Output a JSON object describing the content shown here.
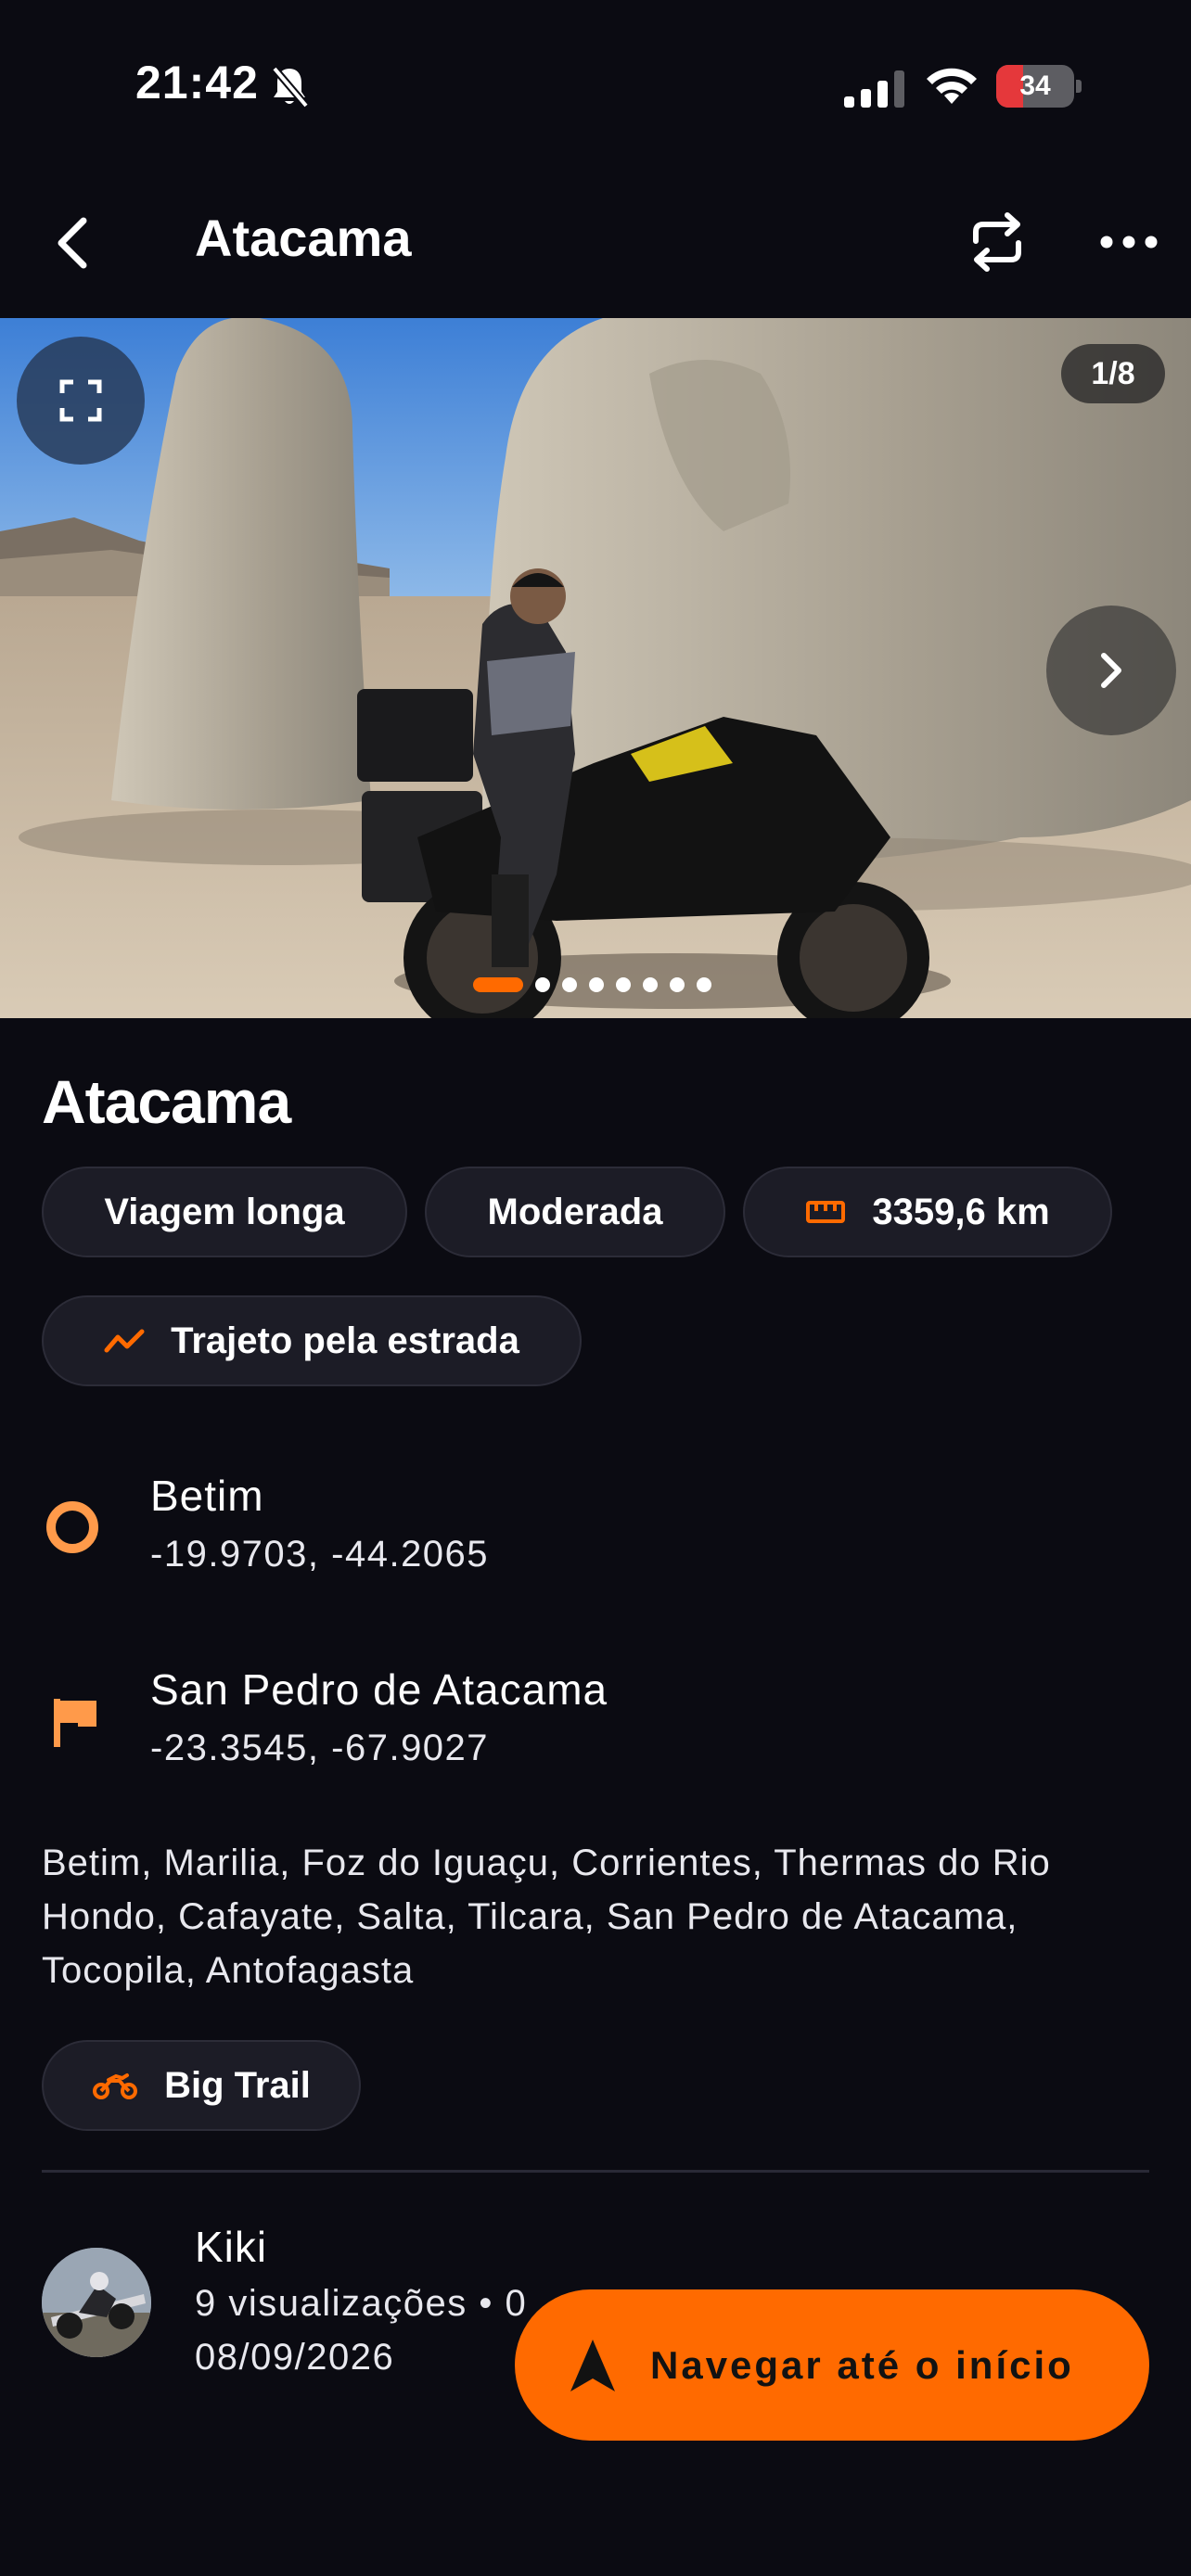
{
  "status_bar": {
    "time": "21:42",
    "battery_level": "34",
    "battery_fraction": 0.34,
    "icons": [
      "bell-slash-icon",
      "cellular-signal-icon",
      "wifi-icon",
      "battery-charging-icon"
    ]
  },
  "header": {
    "title": "Atacama",
    "icons": [
      "back-chevron-icon",
      "repeat-icon",
      "more-dots-icon"
    ]
  },
  "gallery": {
    "counter": "1/8",
    "total": 8,
    "current": 1,
    "icons": [
      "expand-icon",
      "chevron-right-icon"
    ]
  },
  "trip": {
    "title": "Atacama",
    "tags": {
      "type": "Viagem longa",
      "difficulty": "Moderada",
      "distance": "3359,6 km",
      "route": "Trajeto pela estrada",
      "bike": "Big Trail"
    },
    "start": {
      "name": "Betim",
      "coords": "-19.9703, -44.2065"
    },
    "end": {
      "name": "San Pedro de Atacama",
      "coords": "-23.3545, -67.9027"
    },
    "waypoints": "Betim, Marilia, Foz do Iguaçu, Corrientes, Thermas do Rio Hondo, Cafayate, Salta, Tilcara, San Pedro de Atacama, Tocopila, Antofagasta"
  },
  "author": {
    "name": "Kiki",
    "meta": "9 visualizações • 0",
    "date": "08/09/2026"
  },
  "cta": {
    "label": "Navegar até o início"
  },
  "colors": {
    "background": "#0b0b12",
    "accent": "#ff6a00",
    "start_marker": "#ff9a4a",
    "chip_bg": "#1c1c26"
  }
}
